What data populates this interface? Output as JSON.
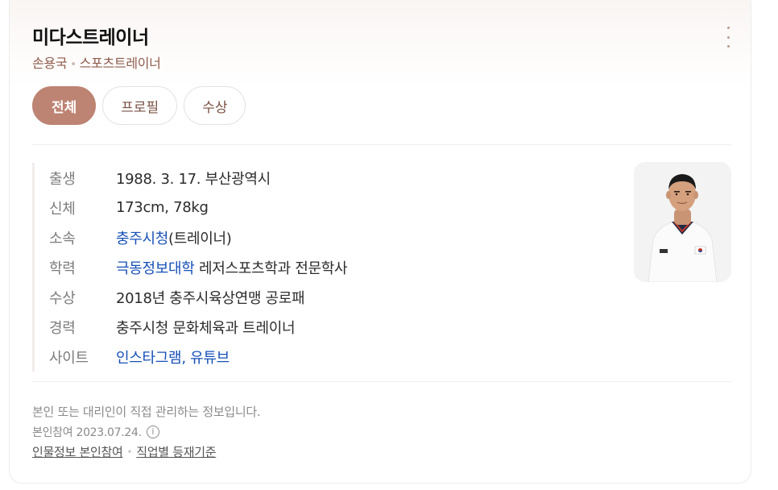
{
  "header": {
    "title": "미다스트레이너",
    "subtitle_name": "손용국",
    "subtitle_job": "스포츠트레이너",
    "more_icon": "more-vertical-icon"
  },
  "tabs": [
    {
      "label": "전체",
      "active": true
    },
    {
      "label": "프로필",
      "active": false
    },
    {
      "label": "수상",
      "active": false
    }
  ],
  "profile": {
    "birth": {
      "label": "출생",
      "value": "1988. 3. 17. 부산광역시"
    },
    "body": {
      "label": "신체",
      "value": "173cm, 78kg"
    },
    "affiliation": {
      "label": "소속",
      "link": "충주시청",
      "suffix": "(트레이너)"
    },
    "education": {
      "label": "학력",
      "link": "극동정보대학",
      "suffix": " 레저스포츠학과 전문학사"
    },
    "award": {
      "label": "수상",
      "value": "2018년 충주시육상연맹 공로패"
    },
    "career": {
      "label": "경력",
      "value": "충주시청 문화체육과 트레이너"
    },
    "site": {
      "label": "사이트",
      "link1": "인스타그램",
      "sep": ", ",
      "link2": "유튜브"
    }
  },
  "footer": {
    "notice": "본인 또는 대리인이 직접 관리하는 정보입니다.",
    "participation_date": "본인참여 2023.07.24.",
    "info_icon": "info-icon",
    "link1": "인물정보 본인참여",
    "link2": "직업별 등재기준"
  },
  "colors": {
    "accent": "#bd8373",
    "subtitle": "#8f5c4c",
    "link": "#1650b8"
  }
}
